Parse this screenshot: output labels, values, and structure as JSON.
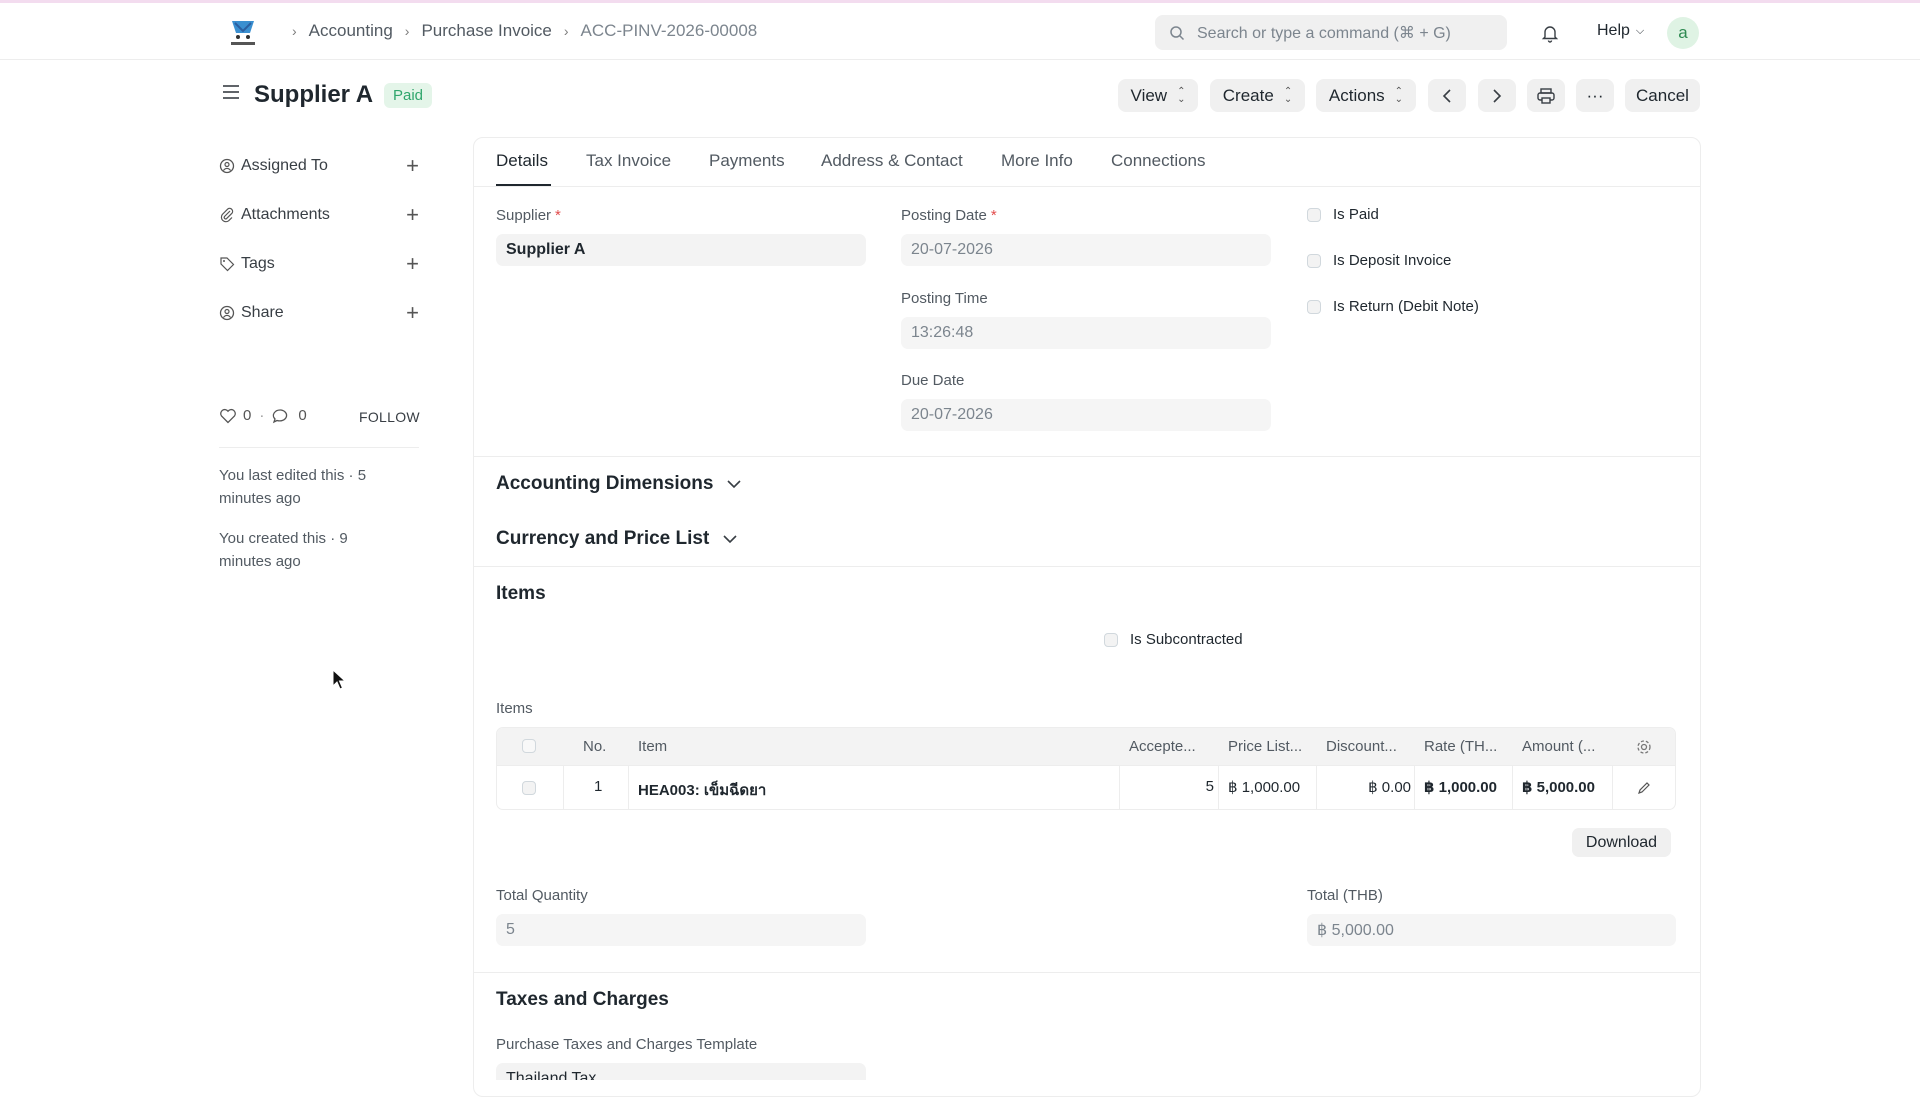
{
  "navbar": {
    "breadcrumbs": [
      "Accounting",
      "Purchase Invoice",
      "ACC-PINV-2026-00008"
    ],
    "search_placeholder": "Search or type a command (⌘ + G)",
    "help_label": "Help",
    "avatar_letter": "a"
  },
  "page": {
    "title": "Supplier A",
    "status": "Paid",
    "buttons": {
      "view": "View",
      "create": "Create",
      "actions": "Actions",
      "cancel": "Cancel",
      "more": "···"
    }
  },
  "sidebar": {
    "items": [
      {
        "label": "Assigned To"
      },
      {
        "label": "Attachments"
      },
      {
        "label": "Tags"
      },
      {
        "label": "Share"
      }
    ],
    "likes": "0",
    "comments": "0",
    "follow": "FOLLOW",
    "activity": [
      "You last edited this · 5 minutes ago",
      "You created this · 9 minutes ago"
    ]
  },
  "tabs": [
    "Details",
    "Tax Invoice",
    "Payments",
    "Address & Contact",
    "More Info",
    "Connections"
  ],
  "details": {
    "supplier_label": "Supplier",
    "supplier_value": "Supplier A",
    "posting_date_label": "Posting Date",
    "posting_date_value": "20-07-2026",
    "posting_time_label": "Posting Time",
    "posting_time_value": "13:26:48",
    "due_date_label": "Due Date",
    "due_date_value": "20-07-2026",
    "checkboxes": [
      "Is Paid",
      "Is Deposit Invoice",
      "Is Return (Debit Note)"
    ]
  },
  "sections": {
    "accounting_dimensions": "Accounting Dimensions",
    "currency_price_list": "Currency and Price List",
    "items": "Items",
    "is_subcontracted": "Is Subcontracted",
    "items_table_label": "Items",
    "taxes": "Taxes and Charges",
    "taxes_template_label": "Purchase Taxes and Charges Template",
    "taxes_template_value": "Thailand Tax"
  },
  "items_table": {
    "headers": [
      "No.",
      "Item",
      "Accepte...",
      "Price List...",
      "Discount...",
      "Rate (TH...",
      "Amount (..."
    ],
    "rows": [
      {
        "no": "1",
        "item": "HEA003: เข็มฉีดยา",
        "accepted": "5",
        "price_list": "฿ 1,000.00",
        "discount": "฿ 0.00",
        "rate": "฿ 1,000.00",
        "amount": "฿ 5,000.00"
      }
    ],
    "download": "Download"
  },
  "totals": {
    "total_qty_label": "Total Quantity",
    "total_qty_value": "5",
    "total_label": "Total (THB)",
    "total_value": "฿ 5,000.00"
  }
}
